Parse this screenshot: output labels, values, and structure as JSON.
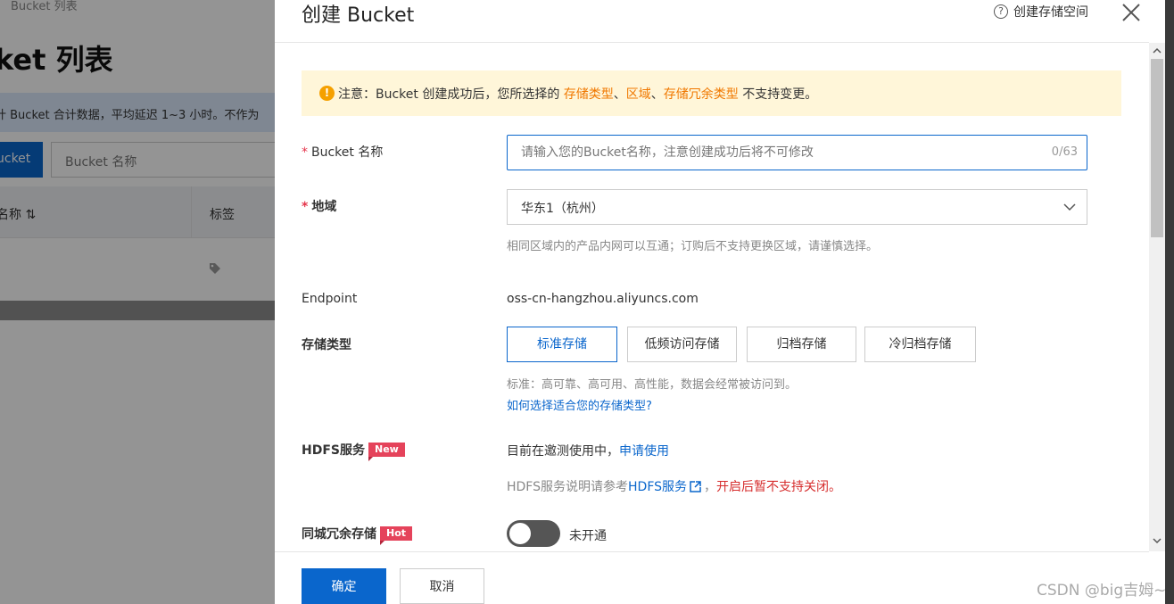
{
  "background": {
    "breadcrumb": "Bucket 列表",
    "title": "ket 列表",
    "notice": "计 Bucket 合计数据，平均延迟 1~3 小时。不作为",
    "create_button": "ucket",
    "search_placeholder": "Bucket 名称",
    "col_name": "名称 ⇅",
    "col_tags": "标签"
  },
  "drawer": {
    "title": "创建 Bucket",
    "help_label": "创建存储空间",
    "warning": {
      "prefix": "注意：Bucket 创建成功后，您所选择的 ",
      "link1": "存储类型",
      "sep1": "、",
      "link2": "区域",
      "sep2": "、",
      "link3": "存储冗余类型",
      "suffix": " 不支持变更。"
    },
    "bucket_name": {
      "label": "Bucket 名称",
      "placeholder": "请输入您的Bucket名称，注意创建成功后将不可修改",
      "counter": "0/63"
    },
    "region": {
      "label": "地域",
      "value": "华东1（杭州）",
      "help": "相同区域内的产品内网可以互通；订购后不支持更换区域，请谨慎选择。"
    },
    "endpoint": {
      "label": "Endpoint",
      "value": "oss-cn-hangzhou.aliyuncs.com"
    },
    "storage_class": {
      "label": "存储类型",
      "options": [
        "标准存储",
        "低频访问存储",
        "归档存储",
        "冷归档存储"
      ],
      "selected": "标准存储",
      "help": "标准：高可靠、高可用、高性能，数据会经常被访问到。",
      "link": "如何选择适合您的存储类型?"
    },
    "hdfs": {
      "label": "HDFS服务",
      "badge": "New",
      "status": "目前在邀测使用中，",
      "apply_link": "申请使用",
      "note_prefix": "HDFS服务说明请参考",
      "note_link": "HDFS服务",
      "note_sep": "，",
      "note_warning": "开启后暂不支持关闭。"
    },
    "zone_redundancy": {
      "label": "同城冗余存储",
      "badge": "Hot",
      "status": "未开通"
    },
    "footer": {
      "ok": "确定",
      "cancel": "取消"
    }
  },
  "watermark": "CSDN @big吉姆~",
  "colors": {
    "primary": "#0a66cc",
    "warning_bg": "#fff6d9",
    "warning_link": "#f07800",
    "badge": "#e5435b",
    "danger": "#d62c2c"
  }
}
